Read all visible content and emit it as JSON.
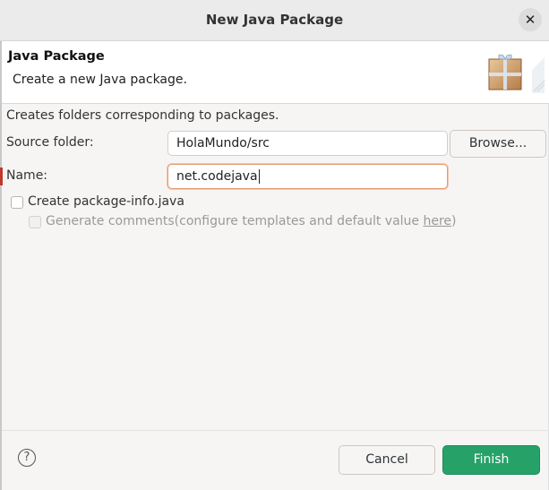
{
  "window": {
    "title": "New Java Package",
    "close_icon": "close-icon"
  },
  "header": {
    "title": "Java Package",
    "description": "Create a new Java package.",
    "icon": "package-icon"
  },
  "form": {
    "description": "Creates folders corresponding to packages.",
    "source_folder_label": "Source folder:",
    "source_folder_value": "HolaMundo/src",
    "browse_label": "Browse...",
    "name_label": "Name:",
    "name_value": "net.codejava",
    "create_package_info_label": "Create package-info.java",
    "create_package_info_checked": false,
    "generate_comments_prefix": "Generate comments",
    "generate_comments_suffix_start": "(configure templates and default value ",
    "generate_comments_link": "here",
    "generate_comments_suffix_end": ")",
    "generate_comments_checked": false,
    "generate_comments_enabled": false
  },
  "footer": {
    "help_icon": "help-icon",
    "help_glyph": "?",
    "cancel_label": "Cancel",
    "finish_label": "Finish"
  },
  "colors": {
    "primary": "#26a269",
    "focus_border": "#e79a72"
  }
}
